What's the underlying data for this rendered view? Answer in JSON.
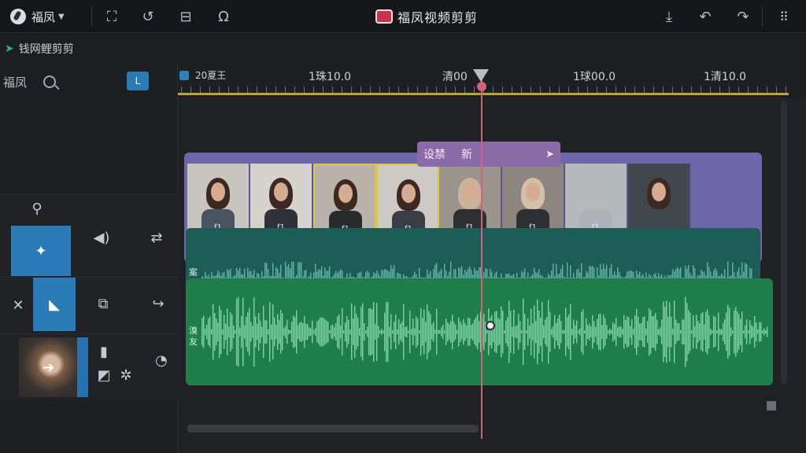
{
  "topbar": {
    "project_name": "福凤",
    "app_title": "福凤视频剪剪",
    "icons": [
      "app-logo-icon",
      "fit-icon",
      "loop-icon",
      "save-icon",
      "omega-icon",
      "export-icon",
      "undo-icon",
      "redo-icon",
      "grid-menu-icon"
    ]
  },
  "subbar": {
    "title": "钱网鲤剪剪"
  },
  "left_panel": {
    "search_label": "福凤",
    "toggle_label": "L"
  },
  "timeline": {
    "ruler_start": "20夏王",
    "time_labels": [
      "1珠10.0",
      "清00",
      "1球00.0",
      "1清10.0"
    ],
    "clip_label": {
      "text_a": "设禁",
      "text_b": "新"
    },
    "audio1_tag": "案搐",
    "audio2_tag": "溴友",
    "frame_badge": "f1"
  },
  "colors": {
    "accent_blue": "#2b7bb9",
    "playhead": "#d4607f",
    "video_track": "#6d67aa",
    "audio_teal": "#1e5c58",
    "audio_green": "#1f7e4c",
    "selection_yellow": "#e2c442"
  }
}
